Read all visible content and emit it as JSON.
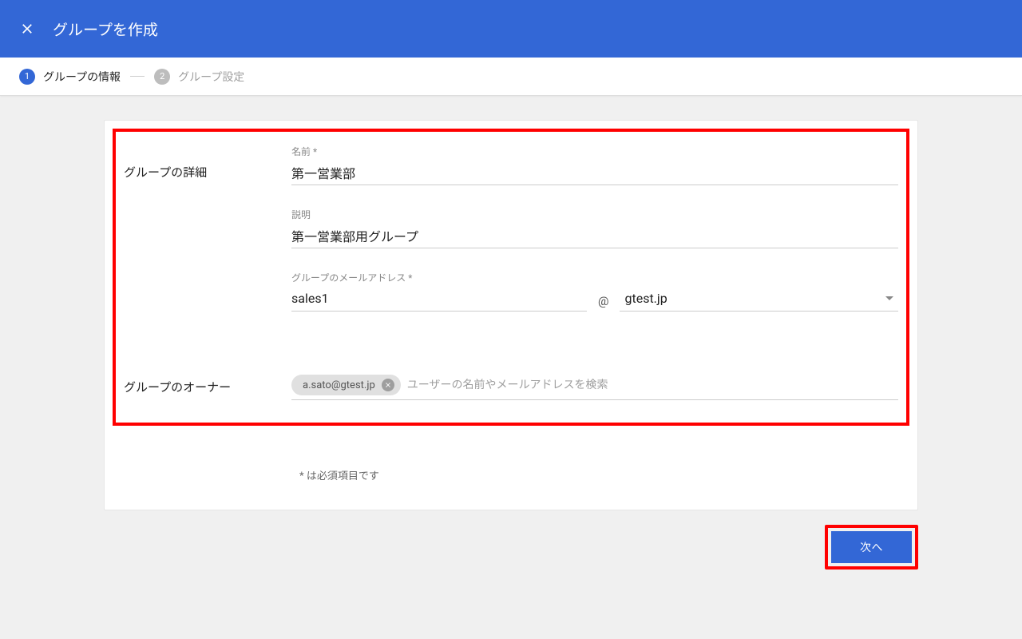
{
  "header": {
    "title": "グループを作成"
  },
  "stepper": {
    "step1": {
      "num": "1",
      "label": "グループの情報"
    },
    "step2": {
      "num": "2",
      "label": "グループ設定"
    }
  },
  "detail_section_label": "グループの詳細",
  "owner_section_label": "グループのオーナー",
  "fields": {
    "name_label": "名前 *",
    "name_value": "第一営業部",
    "desc_label": "説明",
    "desc_value": "第一営業部用グループ",
    "email_label": "グループのメールアドレス *",
    "email_value": "sales1",
    "at": "@",
    "domain_value": "gtest.jp"
  },
  "owner": {
    "chip_text": "a.sato@gtest.jp",
    "placeholder": "ユーザーの名前やメールアドレスを検索"
  },
  "required_note": "* は必須項目です",
  "next_button": "次へ"
}
